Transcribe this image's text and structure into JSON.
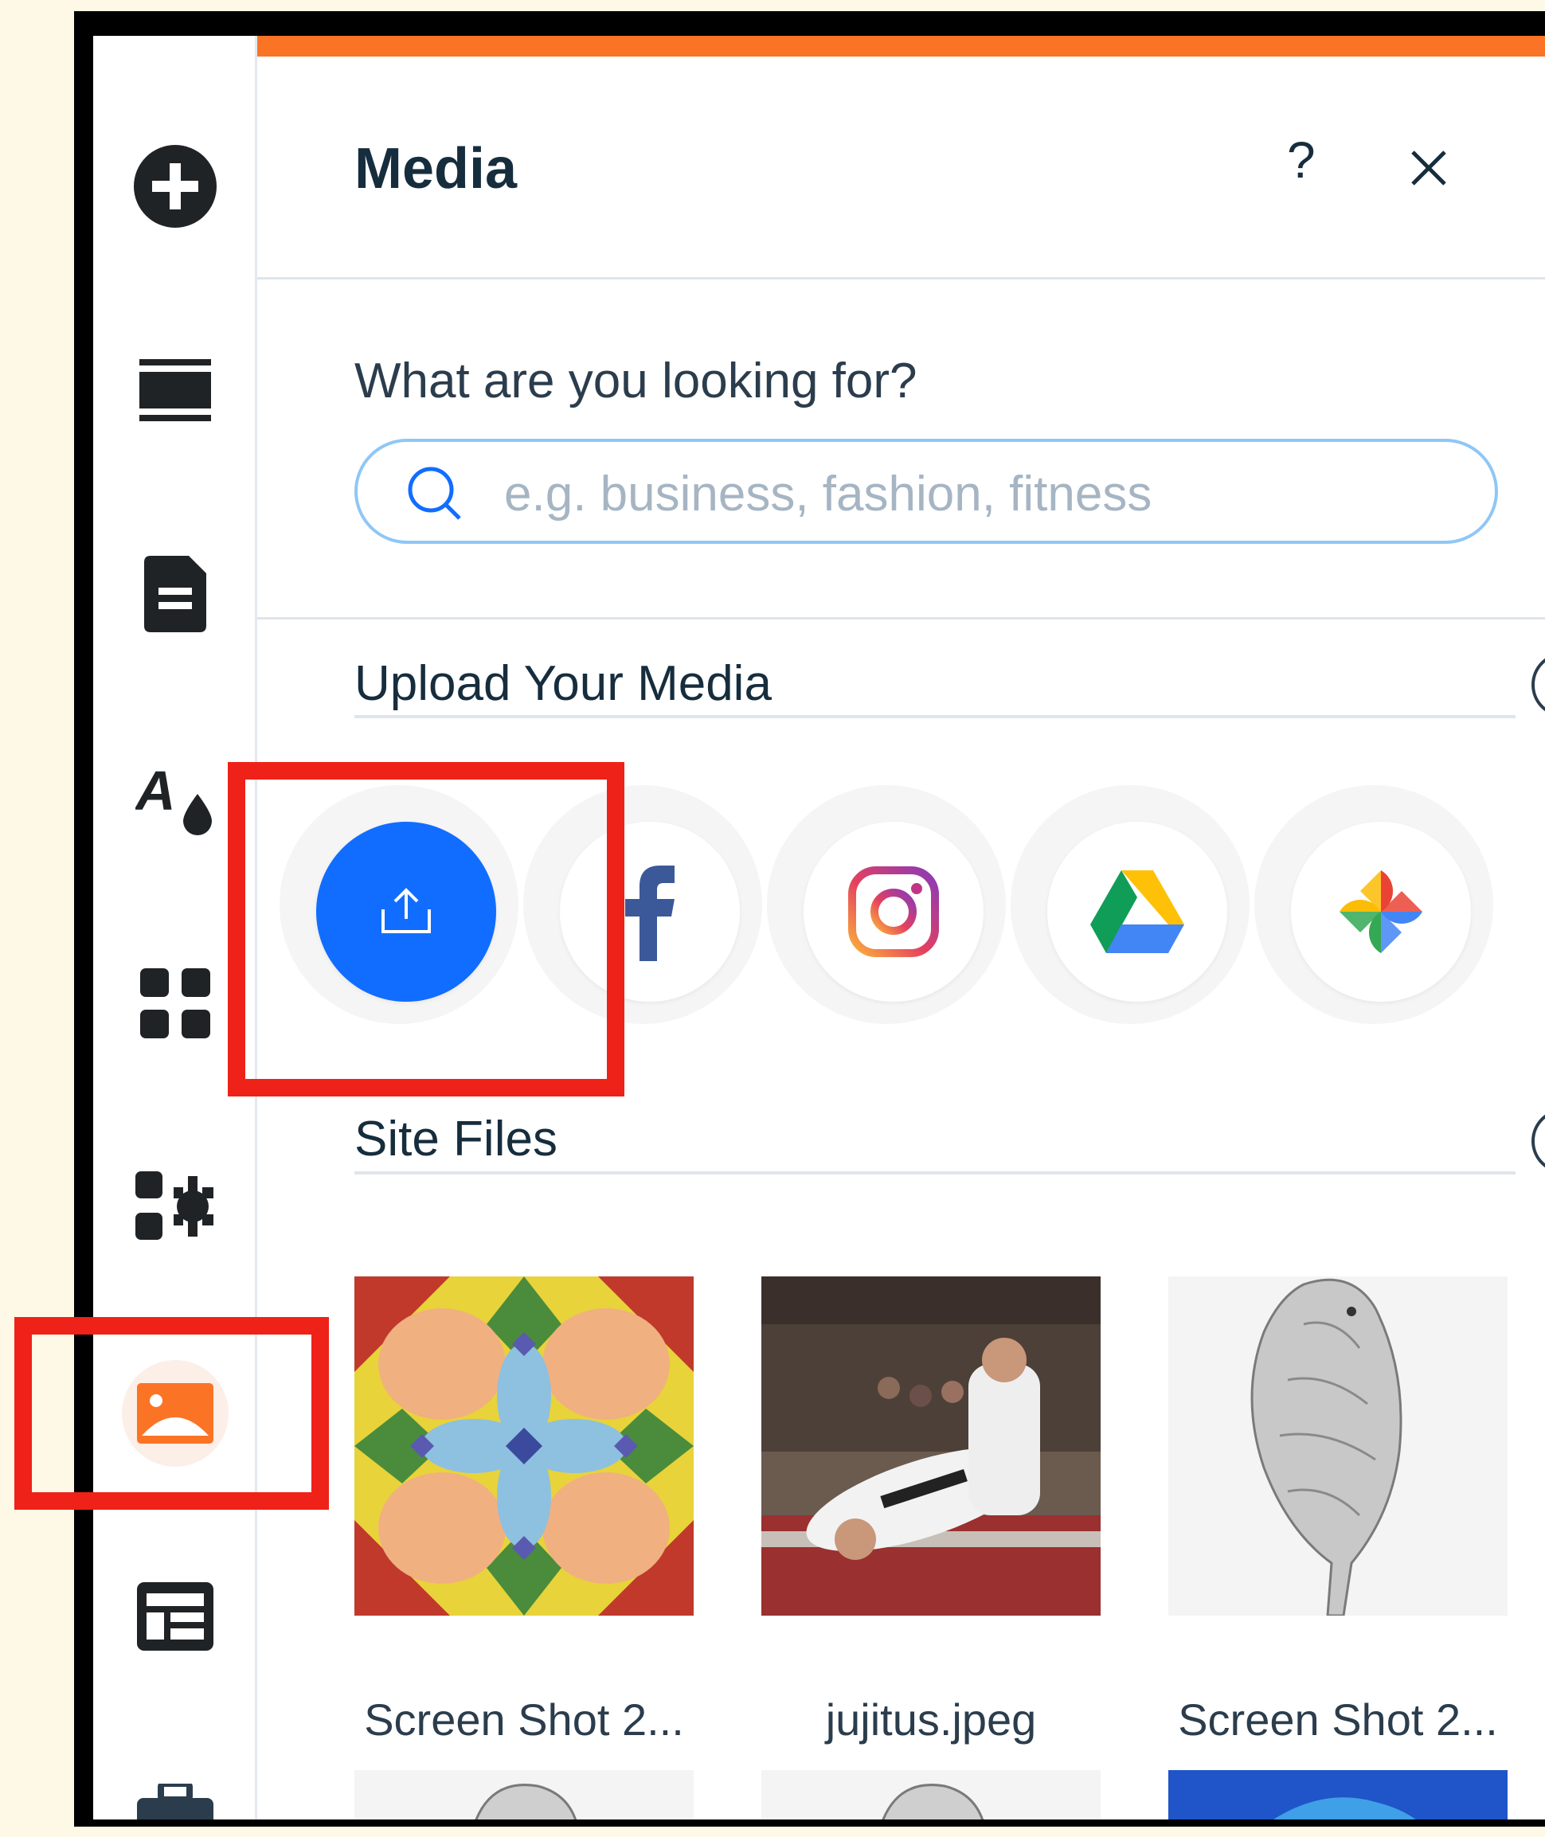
{
  "sidebar": {
    "items": [
      {
        "icon": "add-icon",
        "active": false
      },
      {
        "icon": "menus-icon",
        "active": false
      },
      {
        "icon": "pages-icon",
        "active": false
      },
      {
        "icon": "theme-icon",
        "active": false
      },
      {
        "icon": "apps-icon",
        "active": false
      },
      {
        "icon": "business-apps-icon",
        "active": false
      },
      {
        "icon": "media-icon",
        "active": true
      },
      {
        "icon": "cms-icon",
        "active": false
      },
      {
        "icon": "portfolio-icon",
        "active": false
      }
    ]
  },
  "panel": {
    "title": "Media",
    "help_label": "?",
    "accent_color": "#fb7425"
  },
  "search": {
    "label": "What are you looking for?",
    "placeholder": "e.g. business, fashion, fitness"
  },
  "upload": {
    "title": "Upload Your Media",
    "sources": [
      {
        "icon": "upload-icon",
        "name": "upload"
      },
      {
        "icon": "facebook-icon",
        "name": "facebook"
      },
      {
        "icon": "instagram-icon",
        "name": "instagram"
      },
      {
        "icon": "google-drive-icon",
        "name": "google-drive"
      },
      {
        "icon": "google-photos-icon",
        "name": "google-photos"
      }
    ]
  },
  "site_files": {
    "title": "Site Files",
    "files": [
      {
        "label": "Screen Shot 2..."
      },
      {
        "label": "jujitus.jpeg"
      },
      {
        "label": "Screen Shot 2..."
      }
    ]
  },
  "colors": {
    "primary_blue": "#116dff",
    "highlight_red": "#ee2218",
    "dark_icon": "#202326"
  }
}
